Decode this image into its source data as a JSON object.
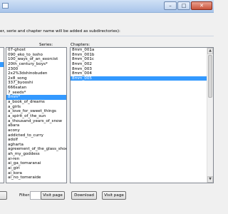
{
  "window": {
    "minimize_glyph": "–",
    "maximize_glyph": "□",
    "close_glyph": "✕"
  },
  "instructions": "er, serie and chapter name will be added as subdirectories):",
  "series_label": "Series:",
  "chapters_label": "Chapters:",
  "series": [
    "07-ghost",
    "090_eko_to_issho",
    "100_ways_of_an_exorcist",
    "20th_century_boys*",
    "2300",
    "2x2%3dshinobuden",
    "2x8_song",
    "337_byooshi",
    "666satan",
    "7_seeds*",
    "8mm*",
    "a_book_of_dreams",
    "a_girls",
    "a_love_for_sweet_things",
    "a_spirit_of_the_sun",
    "a_thousand_years_of_snow",
    "abara",
    "acony",
    "addicted_to_curry",
    "adolf",
    "agharta",
    "agreement_of_the_glass_shoe",
    "ah_my_goddess",
    "ai-ren",
    "ai_ga_tomaranai",
    "ai_girl",
    "ai_kora",
    "ai_no_tomeraide"
  ],
  "series_selected": "8mm*",
  "chapters": [
    "8mm_001a",
    "8mm_001b",
    "8mm_001c",
    "8mm_002",
    "8mm_003",
    "8mm_004",
    "8mm_005"
  ],
  "chapters_selected": "8mm_005",
  "bottom": {
    "filter_label": "Filter:",
    "filter_value": "",
    "visit_page_series": "Visit page",
    "download": "Download",
    "visit_page_chapter": "Visit page"
  }
}
